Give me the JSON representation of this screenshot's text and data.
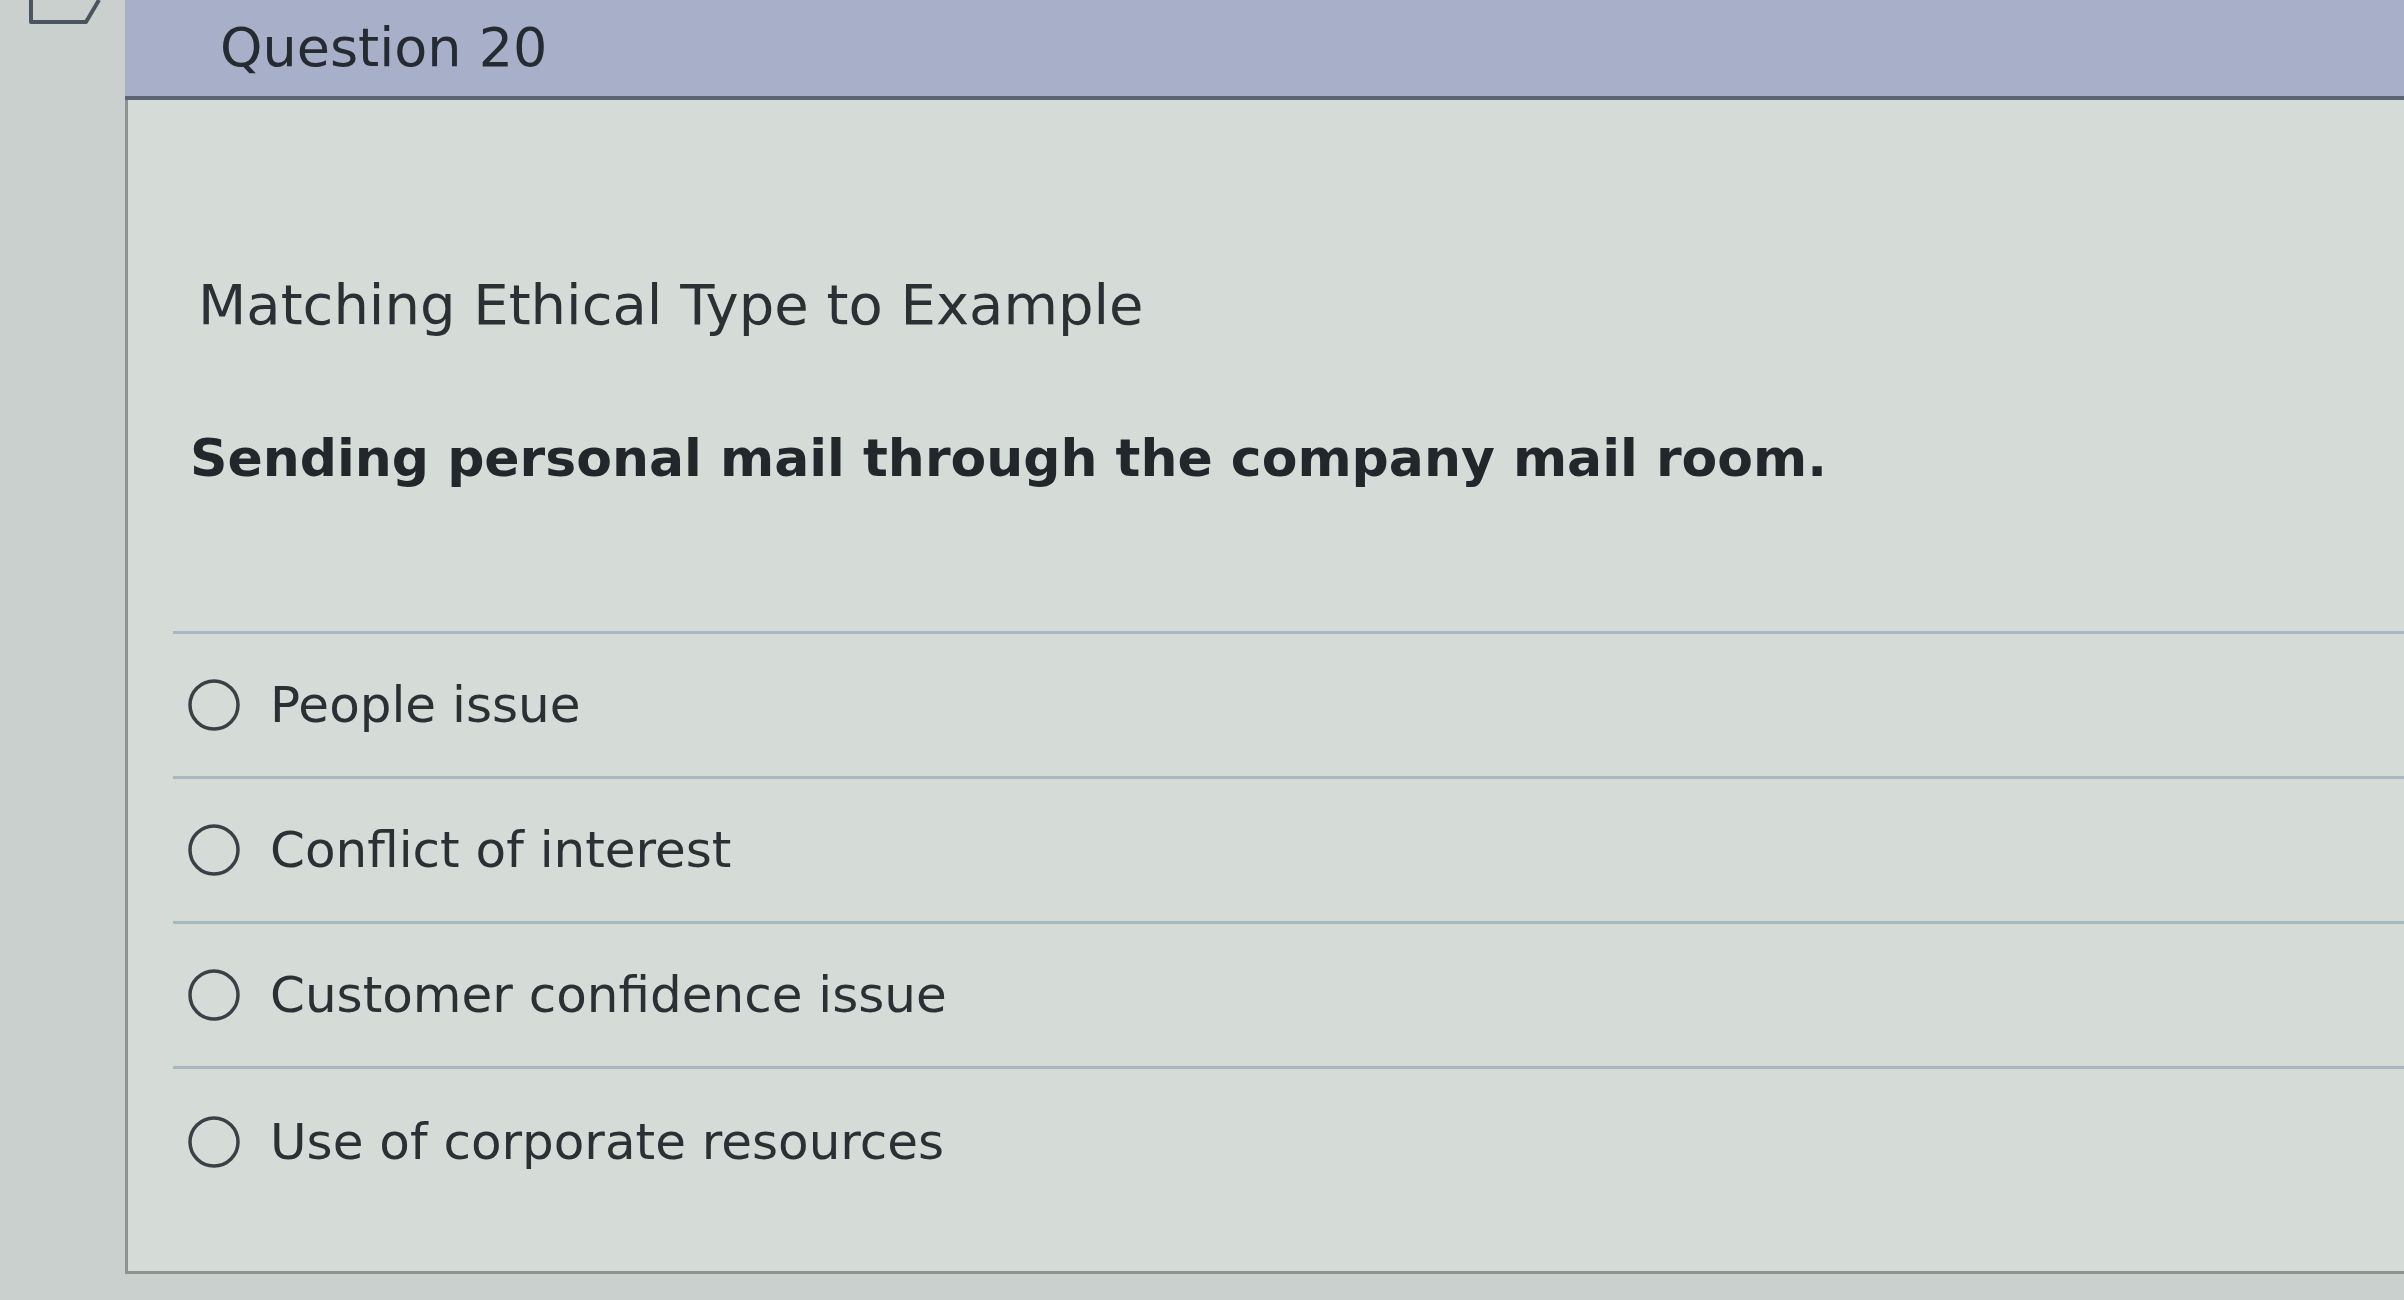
{
  "header": {
    "title": "Question 20"
  },
  "question": {
    "title": "Matching Ethical Type to Example",
    "prompt": "Sending personal mail through the company mail room.",
    "options": [
      {
        "label": "People issue",
        "selected": false
      },
      {
        "label": "Conflict of interest",
        "selected": false
      },
      {
        "label": "Customer confidence issue",
        "selected": false
      },
      {
        "label": "Use of corporate resources",
        "selected": false
      }
    ]
  }
}
